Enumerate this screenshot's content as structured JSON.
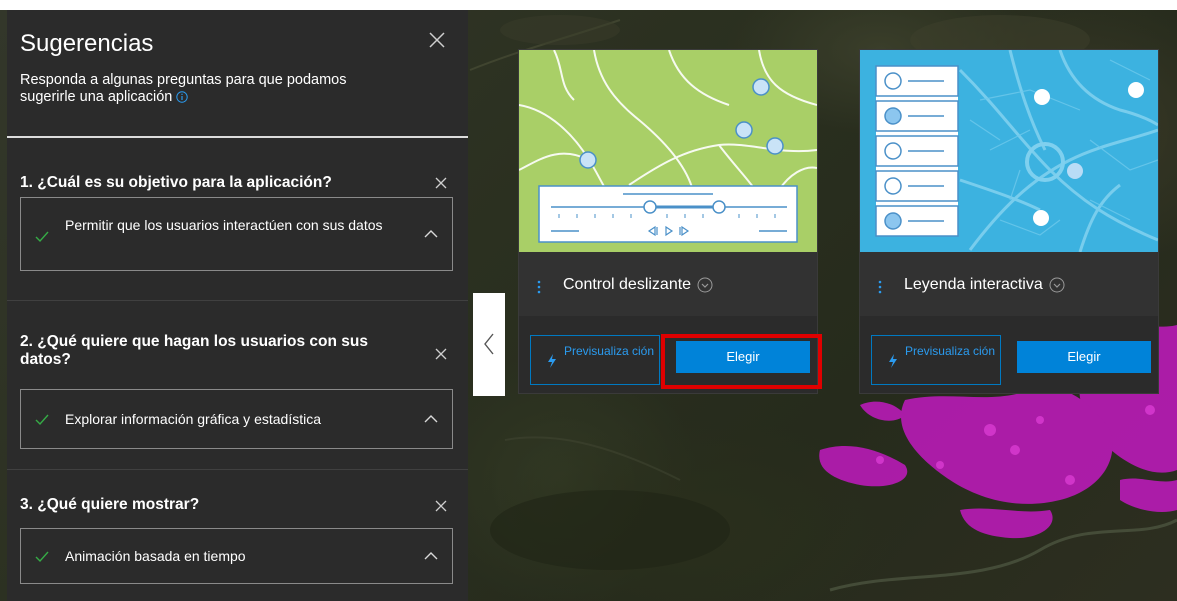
{
  "panel": {
    "title": "Sugerencias",
    "description": "Responda a algunas preguntas para que podamos sugerirle una aplicación"
  },
  "questions": [
    {
      "title": "1. ¿Cuál es su objetivo para la aplicación?",
      "answer": "Permitir que los usuarios interactúen con sus datos"
    },
    {
      "title": "2. ¿Qué quiere que hagan los usuarios con sus datos?",
      "answer": "Explorar información gráfica y estadística"
    },
    {
      "title": "3. ¿Qué quiere mostrar?",
      "answer": "Animación basada en tiempo"
    }
  ],
  "cards": [
    {
      "name": "Control deslizante",
      "preview_label": "Previsualiza ción",
      "choose_label": "Elegir"
    },
    {
      "name": "Leyenda interactiva",
      "preview_label": "Previsualiza ción",
      "choose_label": "Elegir"
    }
  ],
  "colors": {
    "panel_bg": "#2b2b2b",
    "accent_blue": "#0083d9",
    "outline_blue": "#0079c1",
    "check_green": "#35ac46",
    "highlight_red": "#e00000",
    "thumb_green": "#a9cf67",
    "thumb_blue": "#3cb2e0"
  },
  "icons": {
    "close": "close-icon",
    "info": "info-icon",
    "check": "check-icon",
    "chevron_up": "chevron-up-icon",
    "chevron_left": "chevron-left-icon",
    "chevron_circle_down": "chevron-circle-down-icon",
    "bolt": "bolt-icon",
    "more": "vertical-dots-icon"
  }
}
